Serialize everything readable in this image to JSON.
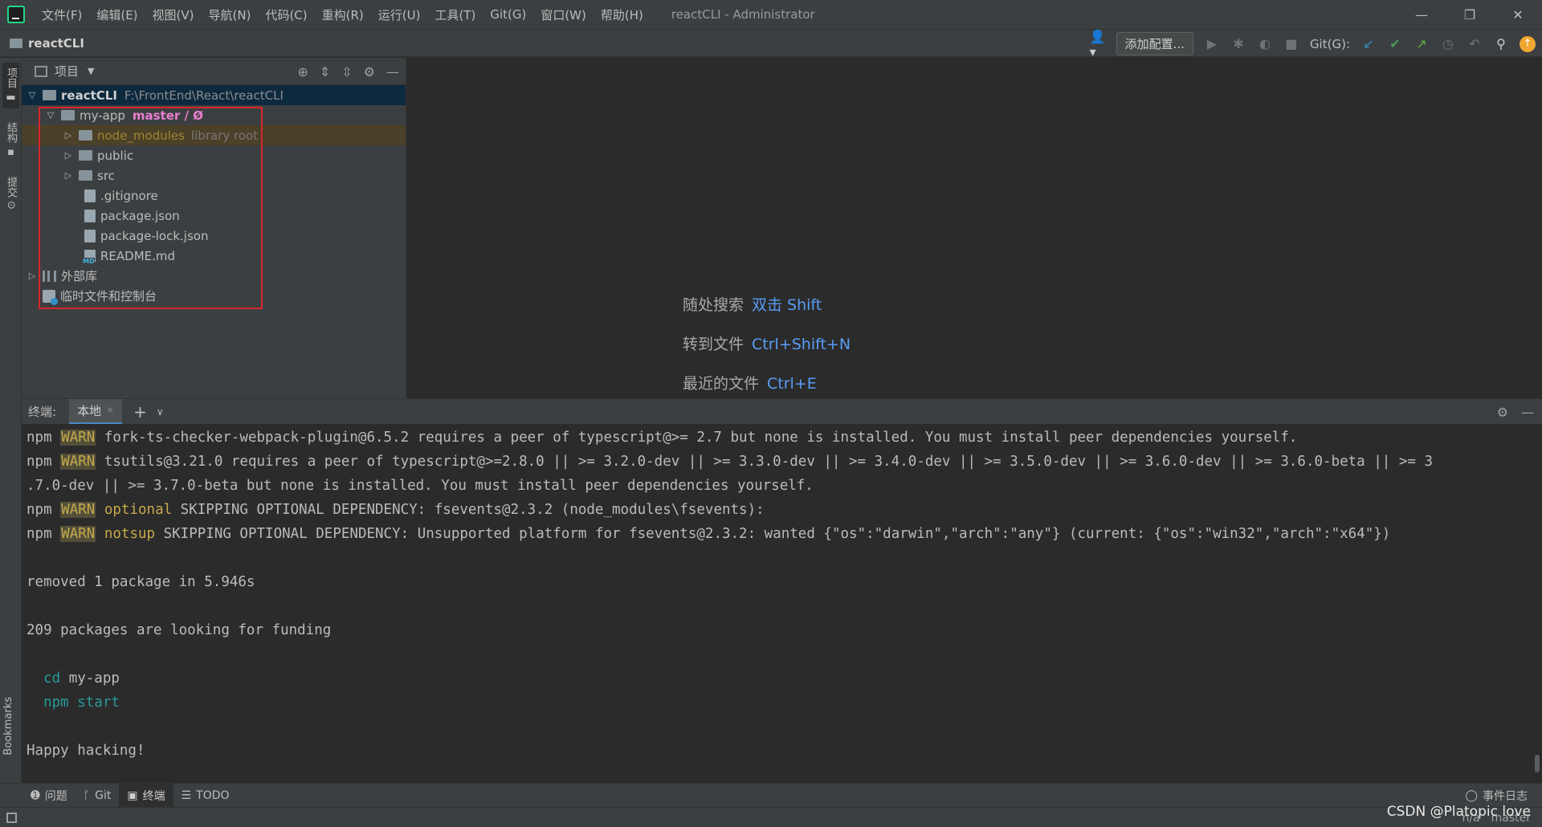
{
  "menu": {
    "items": [
      "文件(F)",
      "编辑(E)",
      "视图(V)",
      "导航(N)",
      "代码(C)",
      "重构(R)",
      "运行(U)",
      "工具(T)",
      "Git(G)",
      "窗口(W)",
      "帮助(H)"
    ],
    "window_title": "reactCLI - Administrator"
  },
  "navbar": {
    "project": "reactCLI",
    "add_config": "添加配置...",
    "git_label": "Git(G):"
  },
  "left_strip": {
    "project_tab": "项目",
    "structure_tab": "结构",
    "commit_tab": "提交",
    "bookmarks_tab": "Bookmarks"
  },
  "project_panel": {
    "title": "项目",
    "tree": {
      "root_name": "reactCLI",
      "root_path": "F:\\FrontEnd\\React\\reactCLI",
      "app_name": "my-app",
      "app_branch": "master / Ø",
      "node_modules": "node_modules",
      "library_root": "library root",
      "public": "public",
      "src": "src",
      "gitignore": ".gitignore",
      "package_json": "package.json",
      "package_lock": "package-lock.json",
      "readme": "README.md",
      "external_libs": "外部库",
      "scratches": "临时文件和控制台"
    }
  },
  "editor": {
    "hints": [
      {
        "label": "随处搜索",
        "key": "双击 Shift"
      },
      {
        "label": "转到文件",
        "key": "Ctrl+Shift+N"
      },
      {
        "label": "最近的文件",
        "key": "Ctrl+E"
      }
    ]
  },
  "terminal": {
    "label": "终端:",
    "tab": "本地",
    "lines": {
      "l1_prefix": "npm ",
      "l1_warn": "WARN",
      "l1_text": " fork-ts-checker-webpack-plugin@6.5.2 requires a peer of typescript@>= 2.7 but none is installed. You must install peer dependencies yourself.",
      "l2_prefix": "npm ",
      "l2_warn": "WARN",
      "l2_text": " tsutils@3.21.0 requires a peer of typescript@>=2.8.0 || >= 3.2.0-dev || >= 3.3.0-dev || >= 3.4.0-dev || >= 3.5.0-dev || >= 3.6.0-dev || >= 3.6.0-beta || >= 3",
      "l3_text": ".7.0-dev || >= 3.7.0-beta but none is installed. You must install peer dependencies yourself.",
      "l4_prefix": "npm ",
      "l4_warn": "WARN",
      "l4_tag": " optional",
      "l4_text": " SKIPPING OPTIONAL DEPENDENCY: fsevents@2.3.2 (node_modules\\fsevents):",
      "l5_prefix": "npm ",
      "l5_warn": "WARN",
      "l5_tag": " notsup",
      "l5_text": " SKIPPING OPTIONAL DEPENDENCY: Unsupported platform for fsevents@2.3.2: wanted {\"os\":\"darwin\",\"arch\":\"any\"} (current: {\"os\":\"win32\",\"arch\":\"x64\"})",
      "removed": "removed 1 package in 5.946s",
      "funding": "209 packages are looking for funding",
      "cd_cmd": "cd",
      "cd_arg": " my-app",
      "npm_start": "npm start",
      "happy": "Happy hacking!"
    }
  },
  "bottom_tabs": {
    "problems": "问题",
    "git": "Git",
    "terminal": "终端",
    "todo": "TODO",
    "event_log": "事件日志"
  },
  "status": {
    "na": "n/a",
    "branch": "master"
  },
  "watermark": "CSDN @Platopic love"
}
